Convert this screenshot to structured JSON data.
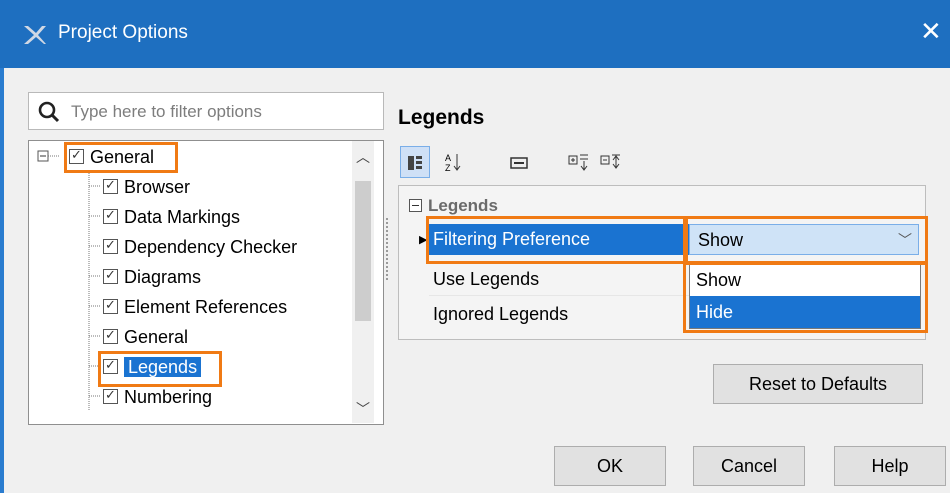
{
  "window": {
    "title": "Project Options",
    "close": "✕"
  },
  "search": {
    "placeholder": "Type here to filter options"
  },
  "tree": {
    "items": [
      {
        "label": "General"
      },
      {
        "label": "Browser"
      },
      {
        "label": "Data Markings"
      },
      {
        "label": "Dependency Checker"
      },
      {
        "label": "Diagrams"
      },
      {
        "label": "Element References"
      },
      {
        "label": "General"
      },
      {
        "label": "Legends"
      },
      {
        "label": "Numbering"
      }
    ]
  },
  "right": {
    "title": "Legends",
    "category": "Legends",
    "rows": [
      {
        "name": "Filtering Preference",
        "value": "Show"
      },
      {
        "name": "Use Legends"
      },
      {
        "name": "Ignored Legends"
      }
    ],
    "dropdown": [
      "Show",
      "Hide"
    ]
  },
  "buttons": {
    "reset": "Reset to Defaults",
    "ok": "OK",
    "cancel": "Cancel",
    "help": "Help"
  },
  "colors": {
    "titlebar": "#1e6fc0",
    "selection": "#1a73d1",
    "highlight": "#f07a14"
  }
}
